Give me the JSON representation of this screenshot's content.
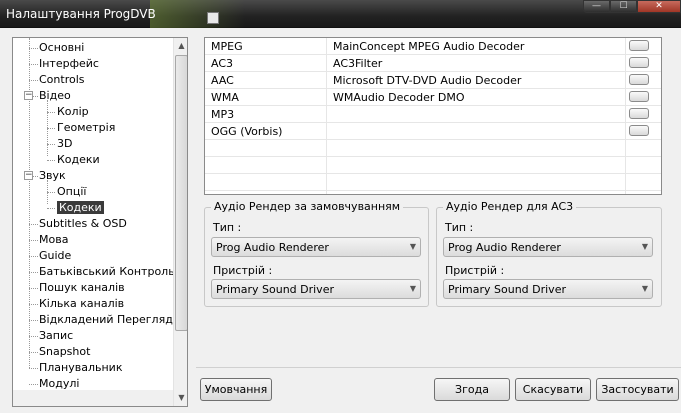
{
  "window": {
    "title": "Налаштування ProgDVB",
    "controls": {
      "minimize": "—",
      "maximize": "☐",
      "close": "✕"
    }
  },
  "tree": {
    "items": [
      {
        "label": "Основні"
      },
      {
        "label": "Інтерфейс"
      },
      {
        "label": "Controls"
      },
      {
        "label": "Відео",
        "expanded": true
      },
      {
        "label": "Колір"
      },
      {
        "label": "Геометрія"
      },
      {
        "label": "3D"
      },
      {
        "label": "Кодеки"
      },
      {
        "label": "Звук",
        "expanded": true
      },
      {
        "label": "Опції"
      },
      {
        "label": "Кодеки",
        "selected": true
      },
      {
        "label": "Subtitles & OSD"
      },
      {
        "label": "Мова"
      },
      {
        "label": "Guide"
      },
      {
        "label": "Батьківський Контроль"
      },
      {
        "label": "Пошук каналів"
      },
      {
        "label": "Кілька каналів"
      },
      {
        "label": "Відкладений Перегляд"
      },
      {
        "label": "Запис"
      },
      {
        "label": "Snapshot"
      },
      {
        "label": "Планувальник"
      },
      {
        "label": "Модулі"
      }
    ],
    "expander_symbol": "−"
  },
  "codecs": [
    {
      "format": "MPEG",
      "decoder": "MainConcept MPEG Audio Decoder"
    },
    {
      "format": "AC3",
      "decoder": "AC3Filter"
    },
    {
      "format": "AAC",
      "decoder": "Microsoft DTV-DVD Audio Decoder"
    },
    {
      "format": "WMA",
      "decoder": "WMAudio Decoder DMO"
    },
    {
      "format": "MP3",
      "decoder": ""
    },
    {
      "format": "OGG (Vorbis)",
      "decoder": ""
    }
  ],
  "default_renderer": {
    "title": "Аудіо Рендер за замовчуванням",
    "type_label": "Тип :",
    "type_value": "Prog Audio Renderer",
    "device_label": "Пристрій :",
    "device_value": "Primary Sound Driver"
  },
  "ac3_renderer": {
    "title": "Аудіо Рендер для AC3",
    "type_label": "Тип :",
    "type_value": "Prog Audio Renderer",
    "device_label": "Пристрій :",
    "device_value": "Primary Sound Driver"
  },
  "buttons": {
    "defaults": "Умовчання",
    "ok": "Згода",
    "cancel": "Скасувати",
    "apply": "Застосувати"
  }
}
